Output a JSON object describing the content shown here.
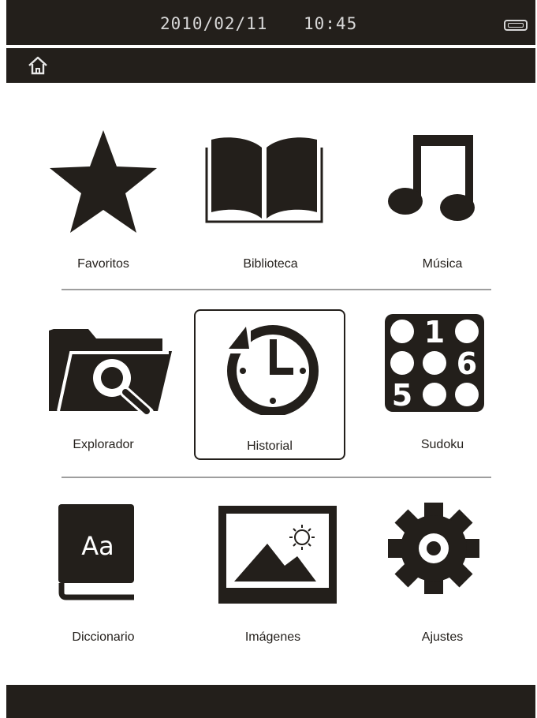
{
  "status_bar": {
    "date": "2010/02/11",
    "time": "10:45",
    "battery_icon": "battery-icon"
  },
  "nav_bar": {
    "home_icon": "home-icon"
  },
  "colors": {
    "bar": "#231f1b",
    "icon": "#231f1b",
    "divider": "#9e9e9e"
  },
  "menu": {
    "rows": [
      [
        {
          "label": "Favoritos",
          "icon": "star-icon"
        },
        {
          "label": "Biblioteca",
          "icon": "book-icon"
        },
        {
          "label": "Música",
          "icon": "music-note-icon"
        }
      ],
      [
        {
          "label": "Explorador",
          "icon": "folder-search-icon"
        },
        {
          "label": "Historial",
          "icon": "history-clock-icon",
          "selected": true
        },
        {
          "label": "Sudoku",
          "icon": "sudoku-icon"
        }
      ],
      [
        {
          "label": "Diccionario",
          "icon": "dictionary-icon"
        },
        {
          "label": "Imágenes",
          "icon": "image-icon"
        },
        {
          "label": "Ajustes",
          "icon": "gear-icon"
        }
      ]
    ]
  },
  "sudoku_digits": [
    "1",
    "6",
    "5"
  ],
  "dictionary_text": "Aa"
}
